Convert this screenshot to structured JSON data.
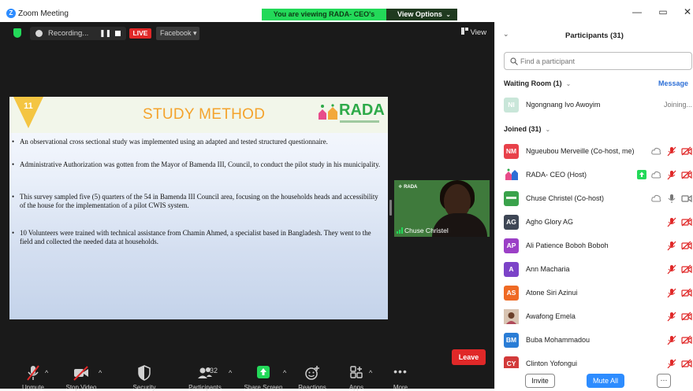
{
  "window": {
    "title": "Zoom Meeting",
    "banner": "You are viewing RADA- CEO's screen",
    "view_options": "View Options",
    "min": "—",
    "max": "▭",
    "close": "✕"
  },
  "meeting": {
    "recording_label": "Recording...",
    "live_label": "LIVE",
    "stream_target": "Facebook ▾",
    "view_label": "View",
    "slide": {
      "number": "11",
      "title": "STUDY METHOD",
      "logo": "RADA",
      "bullets": [
        "An observational cross sectional study was implemented using an adapted and tested structured questionnaire.",
        "Administrative Authorization was gotten from the Mayor of Bamenda III, Council, to conduct the pilot study in his municipality.",
        "This survey sampled five (5) quarters of the 54 in Bamenda III Council area, focusing on the households heads and accessibility of the house for the implementation of a pilot CWIS system.",
        "10 Volunteers were trained with technical assistance from Chamin Ahmed, a specialist based in Bangladesh. They went to the field and collected the needed data at households."
      ]
    },
    "video": {
      "name": "Chuse Christel",
      "logo": "RADA"
    },
    "toolbar": {
      "unmute": "Unmute",
      "stop_video": "Stop Video",
      "security": "Security",
      "participants": "Participants",
      "participants_count": "32",
      "share": "Share Screen",
      "reactions": "Reactions",
      "apps": "Apps",
      "more": "More",
      "leave": "Leave"
    }
  },
  "panel": {
    "collapse": "⌄",
    "title": "Participants (31)",
    "search_placeholder": "Find a participant",
    "waiting_room": "Waiting Room (1)",
    "message": "Message",
    "joined": "Joined (31)",
    "waiting": [
      {
        "initials": "NI",
        "name": "Ngongnang Ivo Awoyim",
        "status": "Joining...",
        "color": "#c9e6d9"
      }
    ],
    "participants": [
      {
        "initials": "NM",
        "name": "Ngueubou Merveille (Co-host, me)",
        "color": "#e8414a"
      },
      {
        "initials": "",
        "name": "RADA- CEO (Host)",
        "color": "#ffffff"
      },
      {
        "initials": "",
        "name": "Chuse Christel (Co-host)",
        "color": "#3aa24b"
      },
      {
        "initials": "AG",
        "name": "Agho Glory AG",
        "color": "#3e4655"
      },
      {
        "initials": "AP",
        "name": "Ali Patience Boboh Boboh",
        "color": "#9b40c6"
      },
      {
        "initials": "A",
        "name": "Ann Macharia",
        "color": "#7c43c8"
      },
      {
        "initials": "AS",
        "name": "Atone Siri Azinui",
        "color": "#ef6a24"
      },
      {
        "initials": "",
        "name": "Awafong Emela",
        "color": "#caa58a"
      },
      {
        "initials": "BM",
        "name": "Buba Mohammadou",
        "color": "#2a7dd6"
      },
      {
        "initials": "CY",
        "name": "Clinton Yofongui",
        "color": "#d23a3a"
      }
    ],
    "invite": "Invite",
    "mute_all": "Mute All",
    "more": "···"
  }
}
